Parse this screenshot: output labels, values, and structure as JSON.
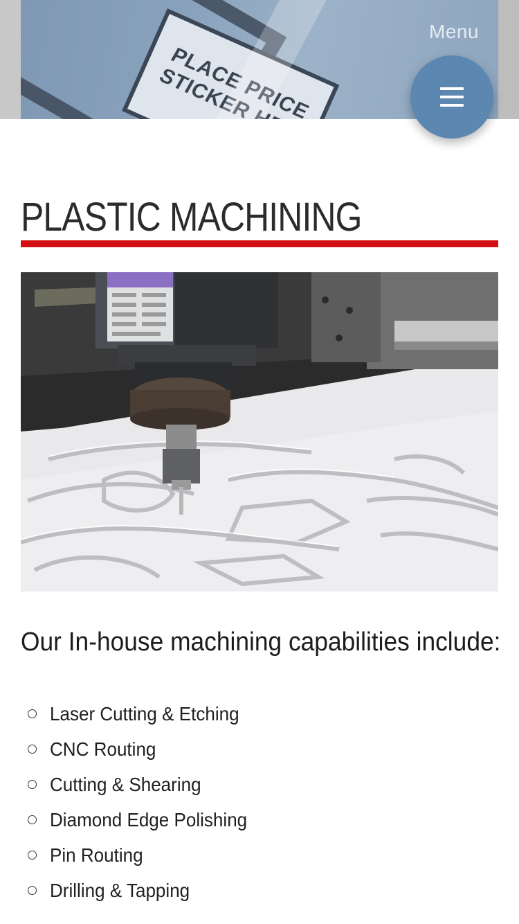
{
  "header": {
    "menu_label": "Menu",
    "hero_sticker_text": "PLACE PRICE\nSTICKER HE"
  },
  "page": {
    "title": "PLASTIC MACHINING",
    "accent_color": "#d30e12",
    "menu_button_color": "#5b87b1"
  },
  "content": {
    "intro": "Our In-house machining capabilities include:",
    "capabilities": [
      "Laser Cutting & Etching",
      "CNC Routing",
      "Cutting & Shearing",
      "Diamond Edge Polishing",
      "Pin Routing",
      "Drilling & Tapping"
    ]
  },
  "icons": {
    "menu": "hamburger-icon",
    "bullet": "hollow-circle"
  }
}
